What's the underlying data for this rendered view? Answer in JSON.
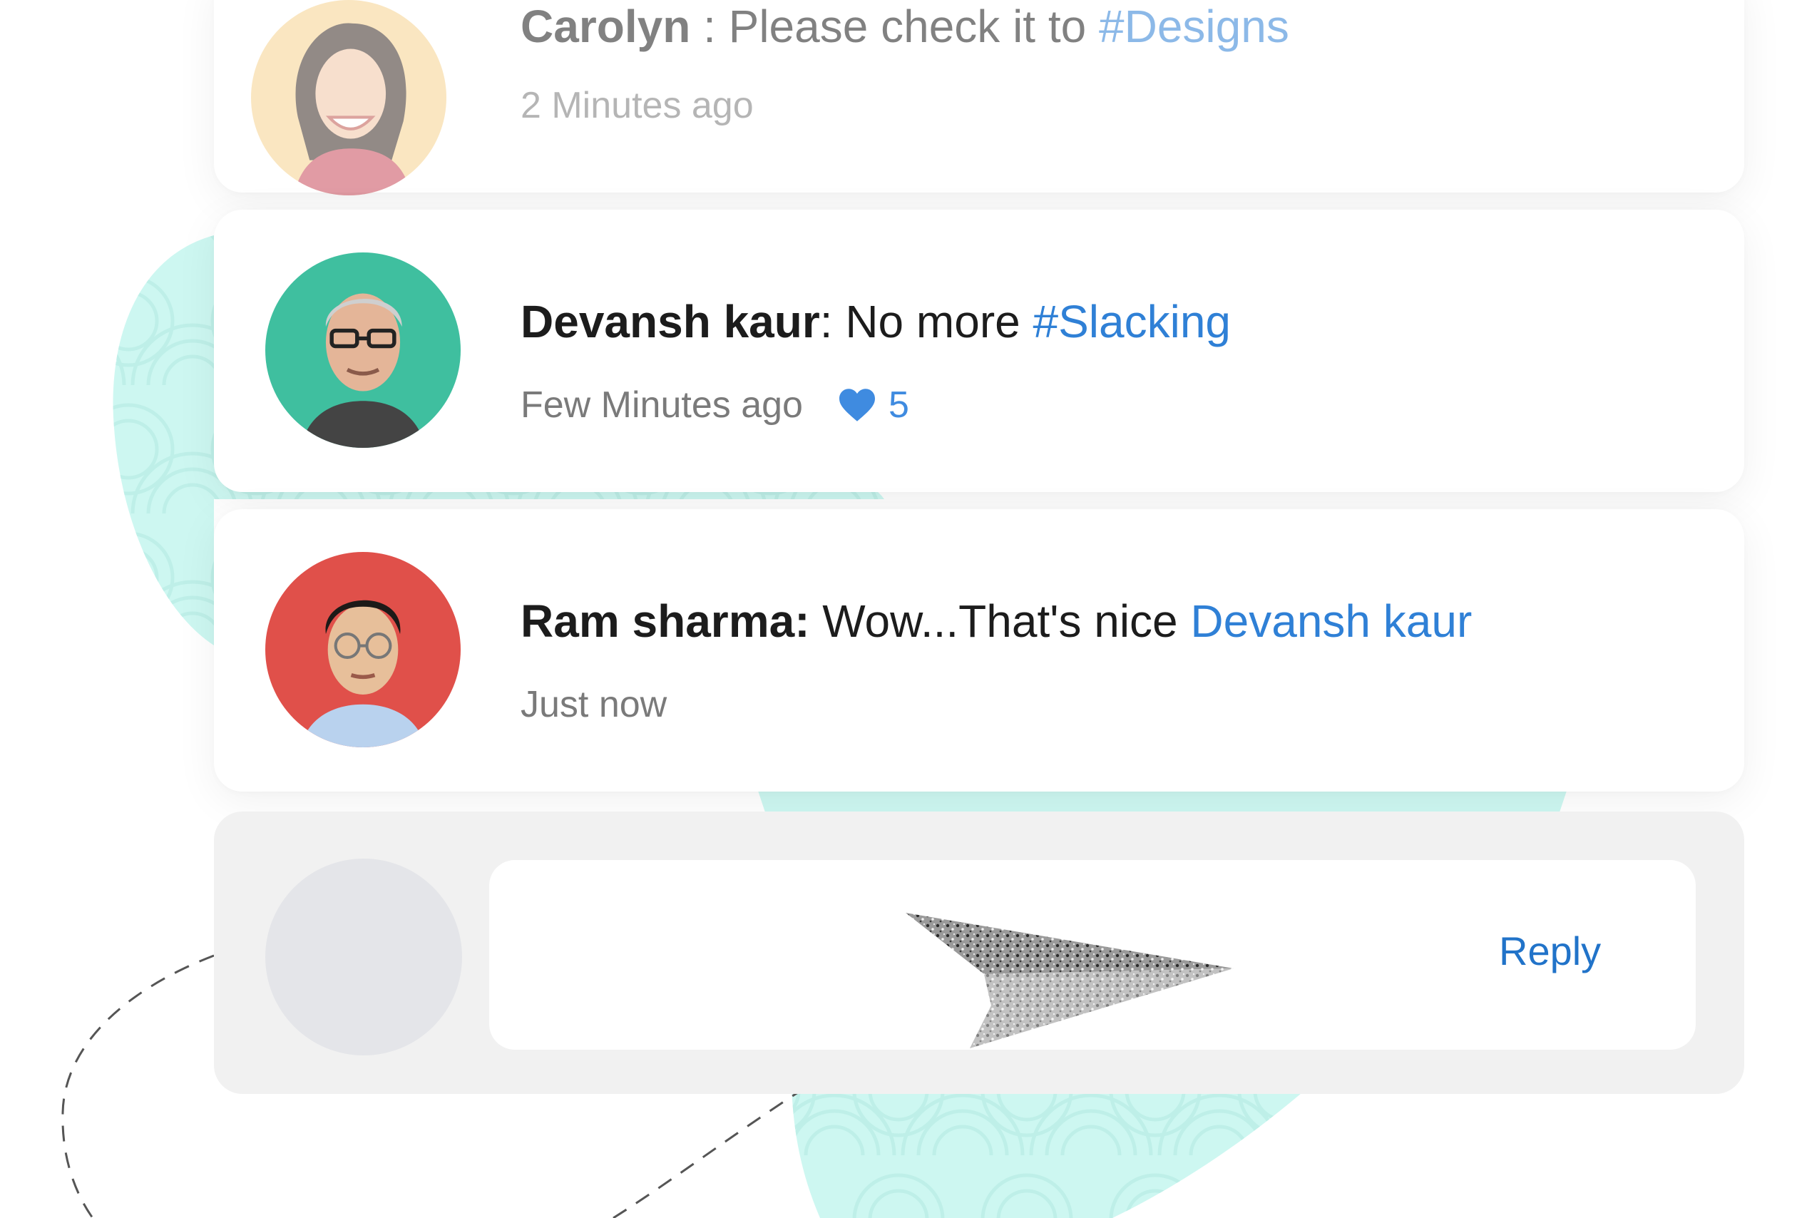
{
  "comments": [
    {
      "author": "Carolyn",
      "separator": " : ",
      "text": "Please check it to ",
      "tag": "#Designs",
      "time": "2 Minutes ago",
      "avatar_color": "#f6d38f"
    },
    {
      "author": "Devansh kaur",
      "separator": ": ",
      "text": "No more ",
      "tag": "#Slacking",
      "time": "Few Minutes ago",
      "likes": "5",
      "avatar_color": "#3fbf9f"
    },
    {
      "author": "Ram sharma:",
      "separator": " ",
      "text": "Wow...That's nice ",
      "tag": "Devansh kaur",
      "time": "Just now",
      "avatar_color": "#e0504a"
    }
  ],
  "reply": {
    "button_label": "Reply",
    "input_value": ""
  },
  "colors": {
    "accent_link": "#2f80d6",
    "reply_button": "#2173c9",
    "like_heart": "#3f8be0",
    "background_blob": "#cdf7f1"
  },
  "icons": {
    "like": "heart-icon",
    "decoration": "paper-plane-icon"
  }
}
